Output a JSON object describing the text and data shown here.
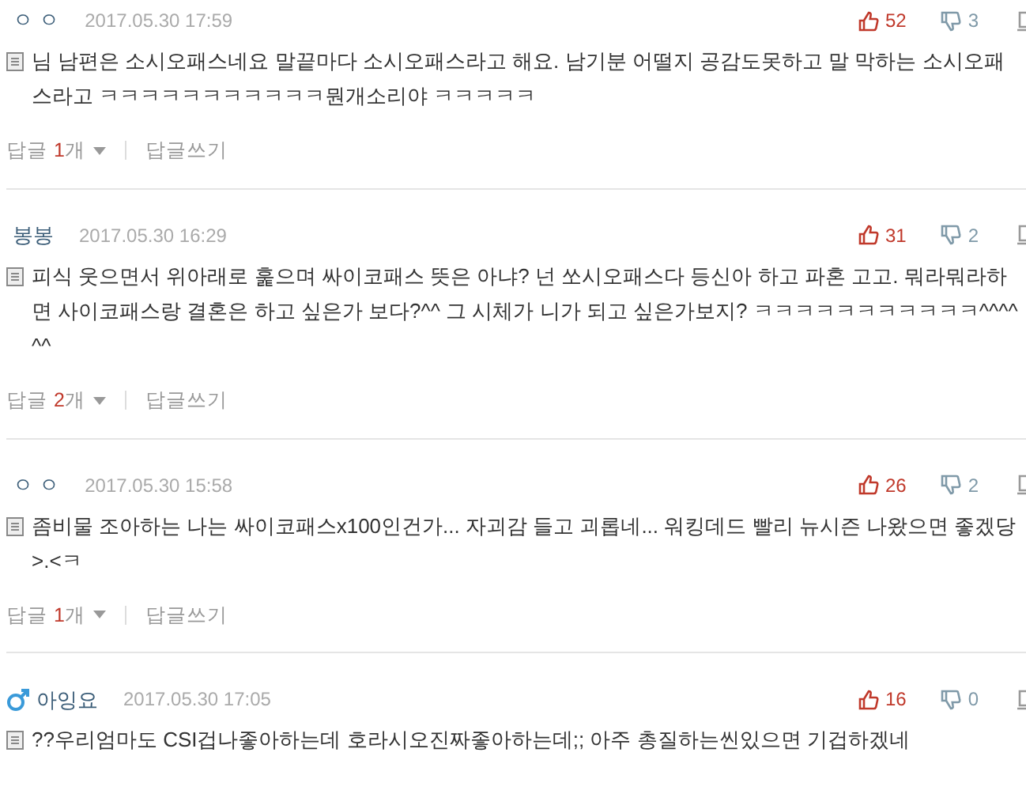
{
  "comments": [
    {
      "author": "ㅇ ㅇ",
      "male": false,
      "date": "2017.05.30 17:59",
      "likes": "52",
      "dislikes": "3",
      "text": "님 남편은 소시오패스네요 말끝마다 소시오패스라고 해요. 남기분 어떨지 공감도못하고 말 막하는 소시오패스라고 ㅋㅋㅋㅋㅋㅋㅋㅋㅋㅋㅋ뭔개소리야 ㅋㅋㅋㅋㅋ",
      "replies": {
        "label": "답글",
        "count": "1",
        "unit": "개",
        "write": "답글쓰기"
      }
    },
    {
      "author": "봉봉",
      "male": false,
      "date": "2017.05.30 16:29",
      "likes": "31",
      "dislikes": "2",
      "text": "피식 웃으면서 위아래로 훑으며 싸이코패스 뜻은 아냐? 넌 쏘시오패스다 등신아 하고 파혼 고고. 뭐라뭐라하면 사이코패스랑 결혼은 하고 싶은가 보다?^^ 그 시체가 니가 되고 싶은가보지? ㅋㅋㅋㅋㅋㅋㅋㅋㅋㅋㅋ^^^^^^",
      "replies": {
        "label": "답글",
        "count": "2",
        "unit": "개",
        "write": "답글쓰기"
      }
    },
    {
      "author": "ㅇ ㅇ",
      "male": false,
      "date": "2017.05.30 15:58",
      "likes": "26",
      "dislikes": "2",
      "text": "좀비물 조아하는 나는 싸이코패스x100인건가... 자괴감 들고 괴롭네... 워킹데드 빨리 뉴시즌 나왔으면 좋겠당>.<ㅋ",
      "replies": {
        "label": "답글",
        "count": "1",
        "unit": "개",
        "write": "답글쓰기"
      }
    },
    {
      "author": "아잉요",
      "male": true,
      "date": "2017.05.30 17:05",
      "likes": "16",
      "dislikes": "0",
      "text": "??우리엄마도 CSI겁나좋아하는데 호라시오진짜좋아하는데;; 아주 총질하는씬있으면 기겁하겠네"
    }
  ]
}
